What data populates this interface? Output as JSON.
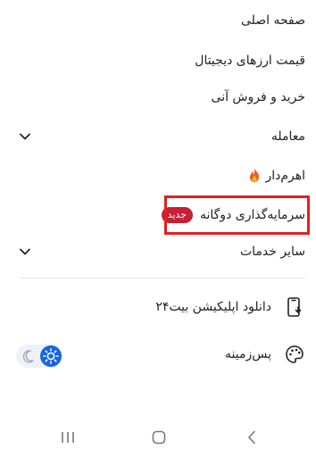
{
  "menu": {
    "home": "صفحه اصلی",
    "prices": "قیمت ارزهای دیجیتال",
    "instant": "خرید و فروش آنی",
    "trade": "معامله",
    "leverage": "اهرم‌دار",
    "dual_investment": "سرمایه‌گذاری دوگانه",
    "dual_badge": "جدید",
    "other_services": "سایر خدمات",
    "download_app": "دانلود اپلیکیشن بیت۲۴",
    "background": "پس‌زمینه"
  },
  "icons": {
    "chevron": "chevron-down-icon",
    "fire": "fire-icon",
    "phone_download": "phone-download-icon",
    "palette": "palette-icon",
    "moon": "moon-icon",
    "sun": "sun-icon"
  },
  "colors": {
    "badge": "#c62039",
    "highlight": "#e02020",
    "toggle_active": "#1565e8"
  },
  "navbar": {
    "recents": "recents-icon",
    "home": "home-icon",
    "back": "back-icon"
  }
}
